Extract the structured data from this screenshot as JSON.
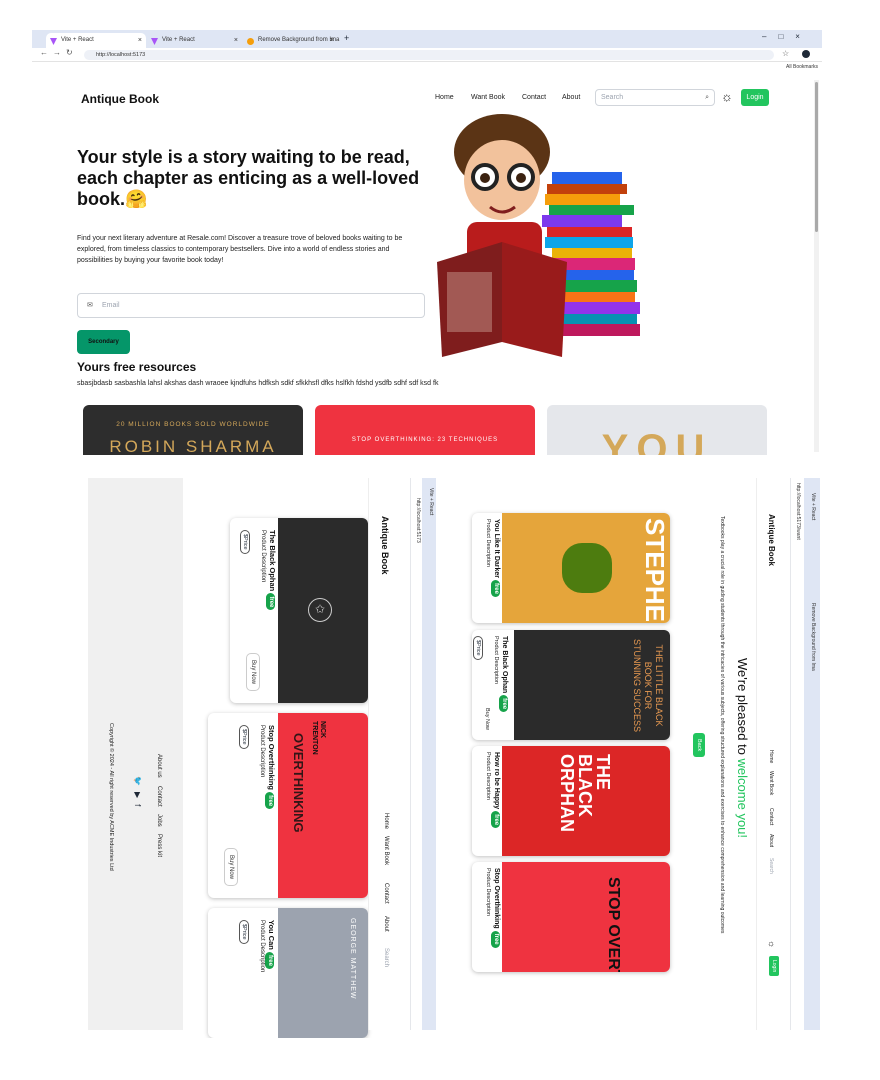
{
  "browser": {
    "tabs": [
      {
        "label": "Vite + React"
      },
      {
        "label": "Vite + React"
      },
      {
        "label": "Remove Background from Ima"
      }
    ],
    "url": "http://localhost:5173",
    "bookmarks_label": "All Bookmarks"
  },
  "nav": {
    "brand": "Antique Book",
    "links": [
      "Home",
      "Want Book",
      "Contact",
      "About"
    ],
    "search_placeholder": "Search",
    "login_label": "Login"
  },
  "hero": {
    "heading": "Your style is a story waiting to be read, each chapter as enticing as a well-loved book.🤗",
    "paragraph": "Find your next literary adventure at Resale.com! Discover a treasure trove of beloved books waiting to be explored, from timeless classics to contemporary bestsellers. Dive into a world of endless stories and possibilities by buying your favorite book today!",
    "email_placeholder": "Email",
    "secondary_button": "Secondary"
  },
  "resources": {
    "heading": "Yours free resources",
    "text": "sbasjbdasb sasbashla lahsl akshas dash wraoee kjndfuhs hdfksh sdkf sfkkhsfl dfks hslfkh fdshd ysdfb sdhf sdf ksd fk"
  },
  "book_strip": [
    {
      "text_top": "20 MILLION BOOKS SOLD WORLDWIDE",
      "text_main": "ROBIN SHARMA"
    },
    {
      "text_top": "STOP OVERTHINKING: 23 TECHNIQUES",
      "text_main": ""
    },
    {
      "text_top": "",
      "text_main": "YOU"
    }
  ],
  "rotated_left": {
    "brand": "Antique Book",
    "nav": [
      "Home",
      "Want Book",
      "Contact",
      "About"
    ],
    "search_placeholder": "Search",
    "tab_label": "Vite + React",
    "url": "http://localhost:5173",
    "footer_links": [
      "About us",
      "Contact",
      "Jobs",
      "Press kit"
    ],
    "copyright": "Copyright © 2024 - All right reserved by ACME Industries Ltd",
    "cards": [
      {
        "title": "The Black Ophan",
        "badge": "free",
        "desc": "Product Description",
        "tag": "$Price",
        "button": "Buy Now"
      },
      {
        "title": "Stop Overthinking",
        "badge": "free",
        "desc": "Product Description",
        "tag": "$Price",
        "button": "Buy Now"
      },
      {
        "title": "You Can",
        "badge": "free",
        "desc": "Product Description",
        "tag": "$Price",
        "button": ""
      }
    ]
  },
  "rotated_right": {
    "brand": "Antique Book",
    "nav": [
      "Home",
      "Want Book",
      "Contact",
      "About"
    ],
    "search_placeholder": "Search",
    "login_label": "Login",
    "welcome_prefix": "We're pleased to ",
    "welcome_highlight": "welcome you!",
    "intro": "Textbooks play a crucial role in guiding students through the intricacies of various subjects, offering structured explanations and exercises to enhance comprehension and learning outcomes",
    "back_button": "Back",
    "url": "http://localhost:5173/want",
    "cards": [
      {
        "title": "You Like It Darker",
        "badge": "free",
        "desc": "Product Description",
        "cover": "STEPHEN KING"
      },
      {
        "title": "The Black Ophan",
        "badge": "free",
        "desc": "Product Description",
        "tag": "$Price",
        "button": "Buy Now",
        "cover": "THE LITTLE BLACK BOOK FOR STUNNING SUCCESS"
      },
      {
        "title": "How ro be Happy",
        "badge": "free",
        "desc": "Product Description",
        "cover": "THE BLACK ORPHAN"
      },
      {
        "title": "Stop Overthinking",
        "badge": "free",
        "desc": "Product Description",
        "cover": "STOP OVERTHINKING"
      }
    ]
  },
  "colors": {
    "accent": "#22c55e",
    "secondary": "#059669",
    "dark": "#1f2937"
  }
}
